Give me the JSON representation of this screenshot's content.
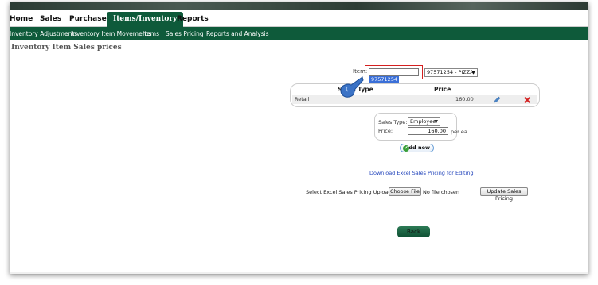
{
  "nav": {
    "tabs": [
      {
        "label": "Home"
      },
      {
        "label": "Sales"
      },
      {
        "label": "Purchases"
      },
      {
        "label": "Items/Inventory"
      },
      {
        "label": "Reports"
      }
    ]
  },
  "subnav": {
    "items": [
      "Inventory Adjustments",
      "Inventory Item Movements",
      "Items",
      "Sales Pricing",
      "Reports and Analysis"
    ]
  },
  "page": {
    "title": "Inventory Item Sales prices"
  },
  "item": {
    "label": "Item:",
    "input_value": "97571254",
    "select_value": "97571254 - PIZZA"
  },
  "prices_table": {
    "headers": {
      "sales_type": "Sales Type",
      "price": "Price"
    },
    "rows": [
      {
        "type": "Retail",
        "price": "160.00"
      }
    ]
  },
  "add_form": {
    "sales_type_label": "Sales Type:",
    "sales_type_value": "Employee",
    "price_label": "Price:",
    "price_value": "160.00",
    "unit": "per ea",
    "add_button": "Add new"
  },
  "download_link": "Download Excel Sales Pricing for Editing",
  "upload": {
    "label": "Select Excel Sales Pricing Upload:",
    "choose_button": "Choose File",
    "file_status": "No file chosen",
    "update_button": "Update Sales Pricing"
  },
  "back_button": "Back",
  "colors": {
    "nav_green": "#0e5a3a",
    "highlight_red": "#d42020",
    "link_blue": "#2244bb"
  },
  "icons": {
    "edit": "pencil-icon",
    "delete": "delete-x-icon",
    "pointer": "hand-pointer-icon",
    "add": "checkmark-icon"
  }
}
